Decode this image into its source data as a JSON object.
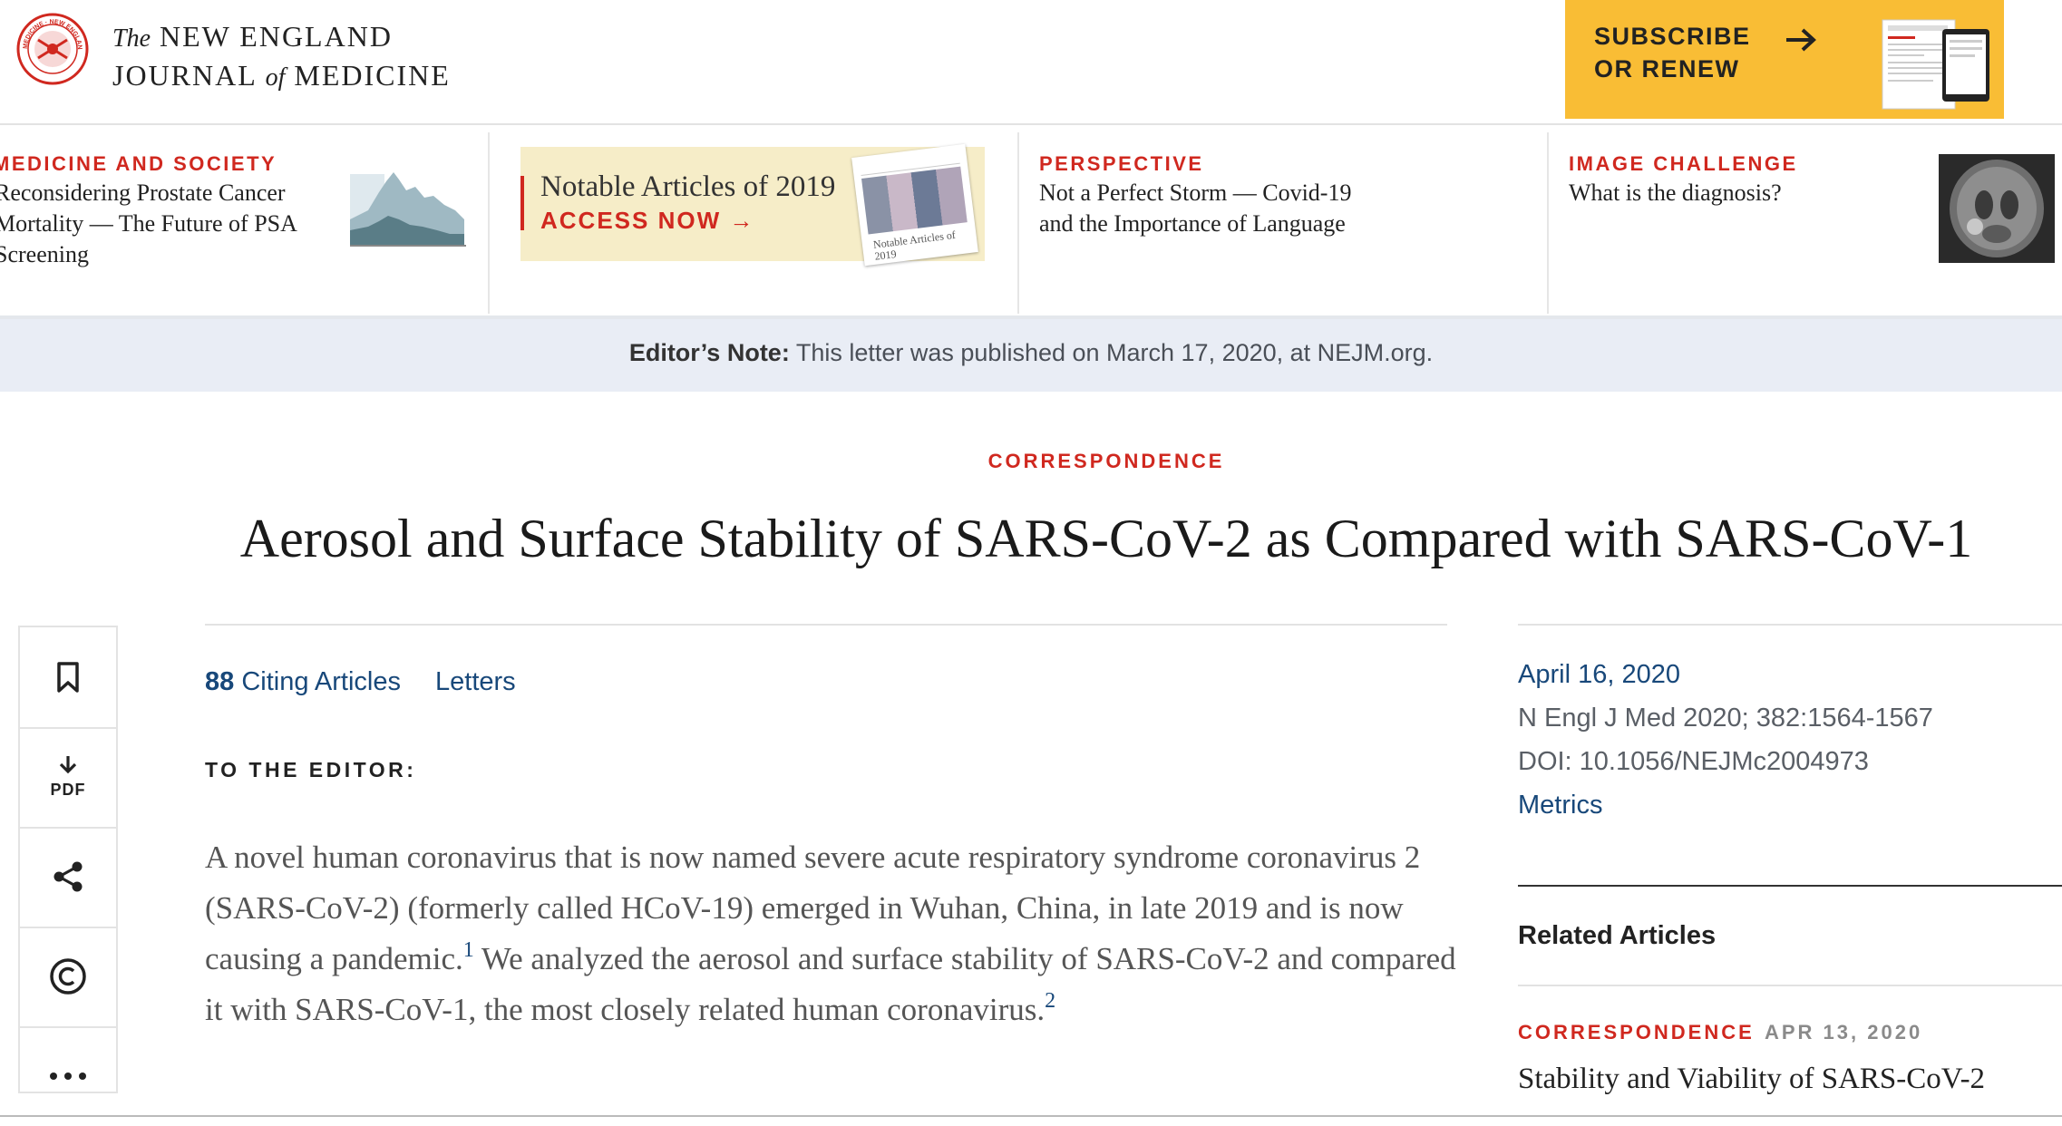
{
  "header": {
    "logo_line1_prefix": "The",
    "logo_line1": "NEW ENGLAND",
    "logo_line2_a": "JOURNAL",
    "logo_line2_of": "of",
    "logo_line2_b": "MEDICINE",
    "seal_text": "MEDICINE · NEW ENGLAND JOURNAL",
    "seal_year": "1812",
    "seal_year2": "2012",
    "subscribe_line1": "SUBSCRIBE",
    "subscribe_line2": "OR RENEW"
  },
  "promos": [
    {
      "kicker": "MEDICINE AND SOCIETY",
      "lines": [
        "Reconsidering Prostate Cancer",
        "Mortality — The Future of PSA",
        "Screening"
      ]
    },
    {
      "title": "Notable Articles of 2019",
      "cta": "ACCESS NOW",
      "cover_text": "Notable Articles of 2019"
    },
    {
      "kicker": "PERSPECTIVE",
      "lines": [
        "Not a Perfect Storm — Covid-19",
        "and the Importance of Language"
      ]
    },
    {
      "kicker": "IMAGE CHALLENGE",
      "lines": [
        "What is the diagnosis?"
      ]
    }
  ],
  "editors_note": {
    "label": "Editor’s Note:",
    "text": " This letter was published on March 17, 2020, at NEJM.org."
  },
  "article": {
    "kicker": "CORRESPONDENCE",
    "title": "Aerosol and Surface Stability of SARS-CoV-2 as Compared with SARS-CoV-1",
    "citing_count": "88",
    "citing_label": " Citing Articles",
    "letters_label": "Letters",
    "to_editor": "TO THE EDITOR:",
    "para_part1": "A novel human coronavirus that is now named severe acute respiratory syndrome coronavirus 2 (SARS-CoV-2) (formerly called HCoV-19) emerged in Wuhan, China, in late 2019 and is now causing a pandemic.",
    "ref1": "1",
    "para_part2": " We analyzed the aerosol and surface stability of SARS-CoV-2 and compared it with SARS-CoV-1, the most closely related human coronavirus.",
    "ref2": "2"
  },
  "tools": {
    "pdf_label": "PDF"
  },
  "meta": {
    "date": "April 16, 2020",
    "citation": "N Engl J Med 2020; 382:1564-1567",
    "doi": "DOI: 10.1056/NEJMc2004973",
    "metrics": "Metrics",
    "related_heading": "Related Articles",
    "related": [
      {
        "kicker": "CORRESPONDENCE",
        "date": "APR 13, 2020",
        "title": "Stability and Viability of SARS-CoV-2"
      }
    ]
  },
  "colors": {
    "accent_red": "#d0281f",
    "link_blue": "#18487a",
    "subscribe_yellow": "#f9bd35",
    "note_bg": "#e9edf5"
  }
}
